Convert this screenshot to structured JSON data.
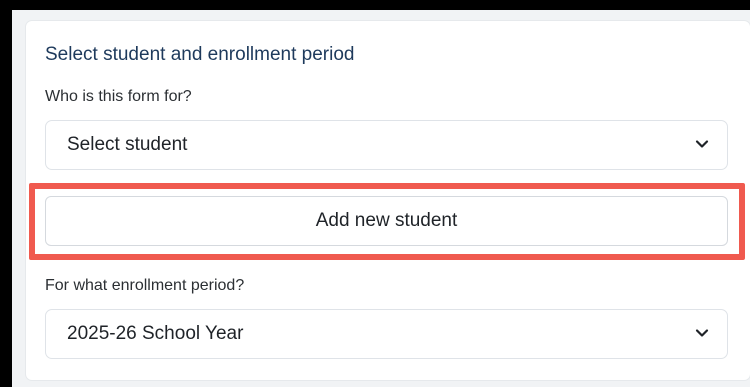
{
  "form": {
    "section_title": "Select student and enrollment period",
    "student": {
      "label": "Who is this form for?",
      "value": "Select student",
      "icon": "chevron-down-icon"
    },
    "add_student_label": "Add new student",
    "period": {
      "label": "For what enrollment period?",
      "value": "2025-26 School Year",
      "icon": "chevron-down-icon"
    }
  },
  "colors": {
    "highlight": "#f05a4f",
    "title": "#1e3a5c"
  }
}
